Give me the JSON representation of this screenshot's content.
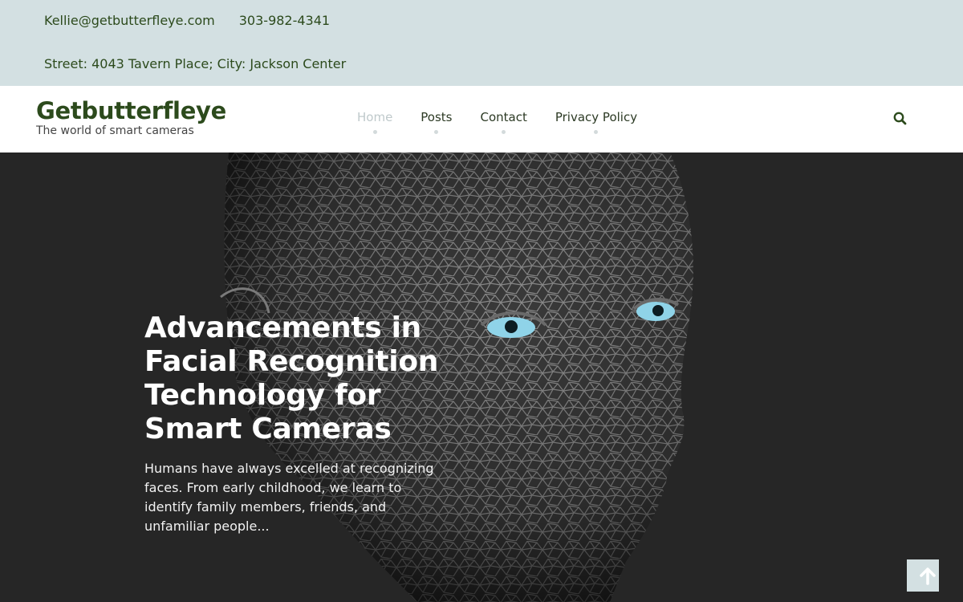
{
  "topbar": {
    "email": "Kellie@getbutterfleye.com",
    "phone": "303-982-4341",
    "address": "Street: 4043 Tavern Place; City: Jackson Center"
  },
  "header": {
    "site_title": "Getbutterfleye",
    "tagline": "The world of smart cameras",
    "nav": [
      {
        "label": "Home",
        "active": true
      },
      {
        "label": "Posts",
        "active": false
      },
      {
        "label": "Contact",
        "active": false
      },
      {
        "label": "Privacy Policy",
        "active": false
      }
    ],
    "search_icon": "search-icon"
  },
  "hero": {
    "title": "Advancements in Facial Recognition Technology for Smart Cameras",
    "excerpt": "Humans have always excelled at recognizing faces. From early childhood, we learn to identify family members, friends, and unfamiliar people...",
    "image": "wireframe-face-illustration"
  },
  "scroll_top_icon": "arrow-up-icon",
  "colors": {
    "topbar_bg": "#d3e0e2",
    "brand_green": "#2c4a1c",
    "hero_bg": "#262626",
    "eye_blue": "#8fd3e8"
  }
}
